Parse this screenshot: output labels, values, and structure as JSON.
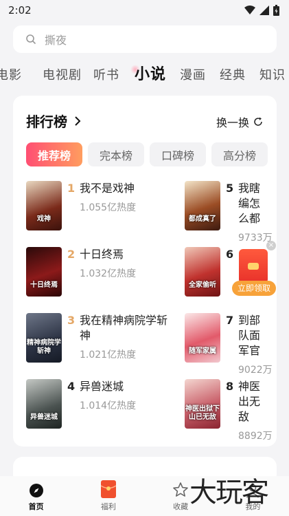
{
  "status_bar": {
    "time": "2:02"
  },
  "search": {
    "placeholder": "撕夜"
  },
  "tabs": [
    {
      "label": "电影"
    },
    {
      "label": "电视剧"
    },
    {
      "label": "听书"
    },
    {
      "label": "小说"
    },
    {
      "label": "漫画"
    },
    {
      "label": "经典"
    },
    {
      "label": "知识"
    }
  ],
  "ranking": {
    "title": "排行榜",
    "refresh_label": "换一换",
    "chips": [
      "推荐榜",
      "完本榜",
      "口碑榜",
      "高分榜"
    ],
    "books_left": [
      {
        "rank": "1",
        "name": "我不是戏神",
        "heat": "1.055亿热度",
        "cover_text": "戏神"
      },
      {
        "rank": "2",
        "name": "十日终焉",
        "heat": "1.032亿热度",
        "cover_text": "十日终焉"
      },
      {
        "rank": "3",
        "name": "我在精神病院学斩神",
        "heat": "1.021亿热度",
        "cover_text": "精神病院学斩神"
      },
      {
        "rank": "4",
        "name": "异兽迷城",
        "heat": "1.014亿热度",
        "cover_text": "异兽迷城"
      }
    ],
    "books_right": [
      {
        "rank": "5",
        "name": "我瞎编怎么都",
        "heat": "9733万",
        "cover_text": "都成真了"
      },
      {
        "rank": "6",
        "name": "",
        "heat": "",
        "cover_text": "全家偷听"
      },
      {
        "rank": "7",
        "name": "到部队面军官",
        "heat": "9022万",
        "cover_text": "随军家属"
      },
      {
        "rank": "8",
        "name": "神医出无敌",
        "heat": "8892万",
        "cover_text": "神医出狱下山已无敌"
      }
    ]
  },
  "red_packet": {
    "button_label": "立即领取",
    "close_label": "×"
  },
  "bottom_nav": [
    {
      "label": "首页"
    },
    {
      "label": "福利"
    },
    {
      "label": "收藏"
    },
    {
      "label": "我的"
    }
  ],
  "watermark": {
    "text": "大玩客"
  },
  "colors": {
    "accent": "#ff4f73",
    "rank_top": "#e4a766",
    "background": "#f4f4f6"
  }
}
